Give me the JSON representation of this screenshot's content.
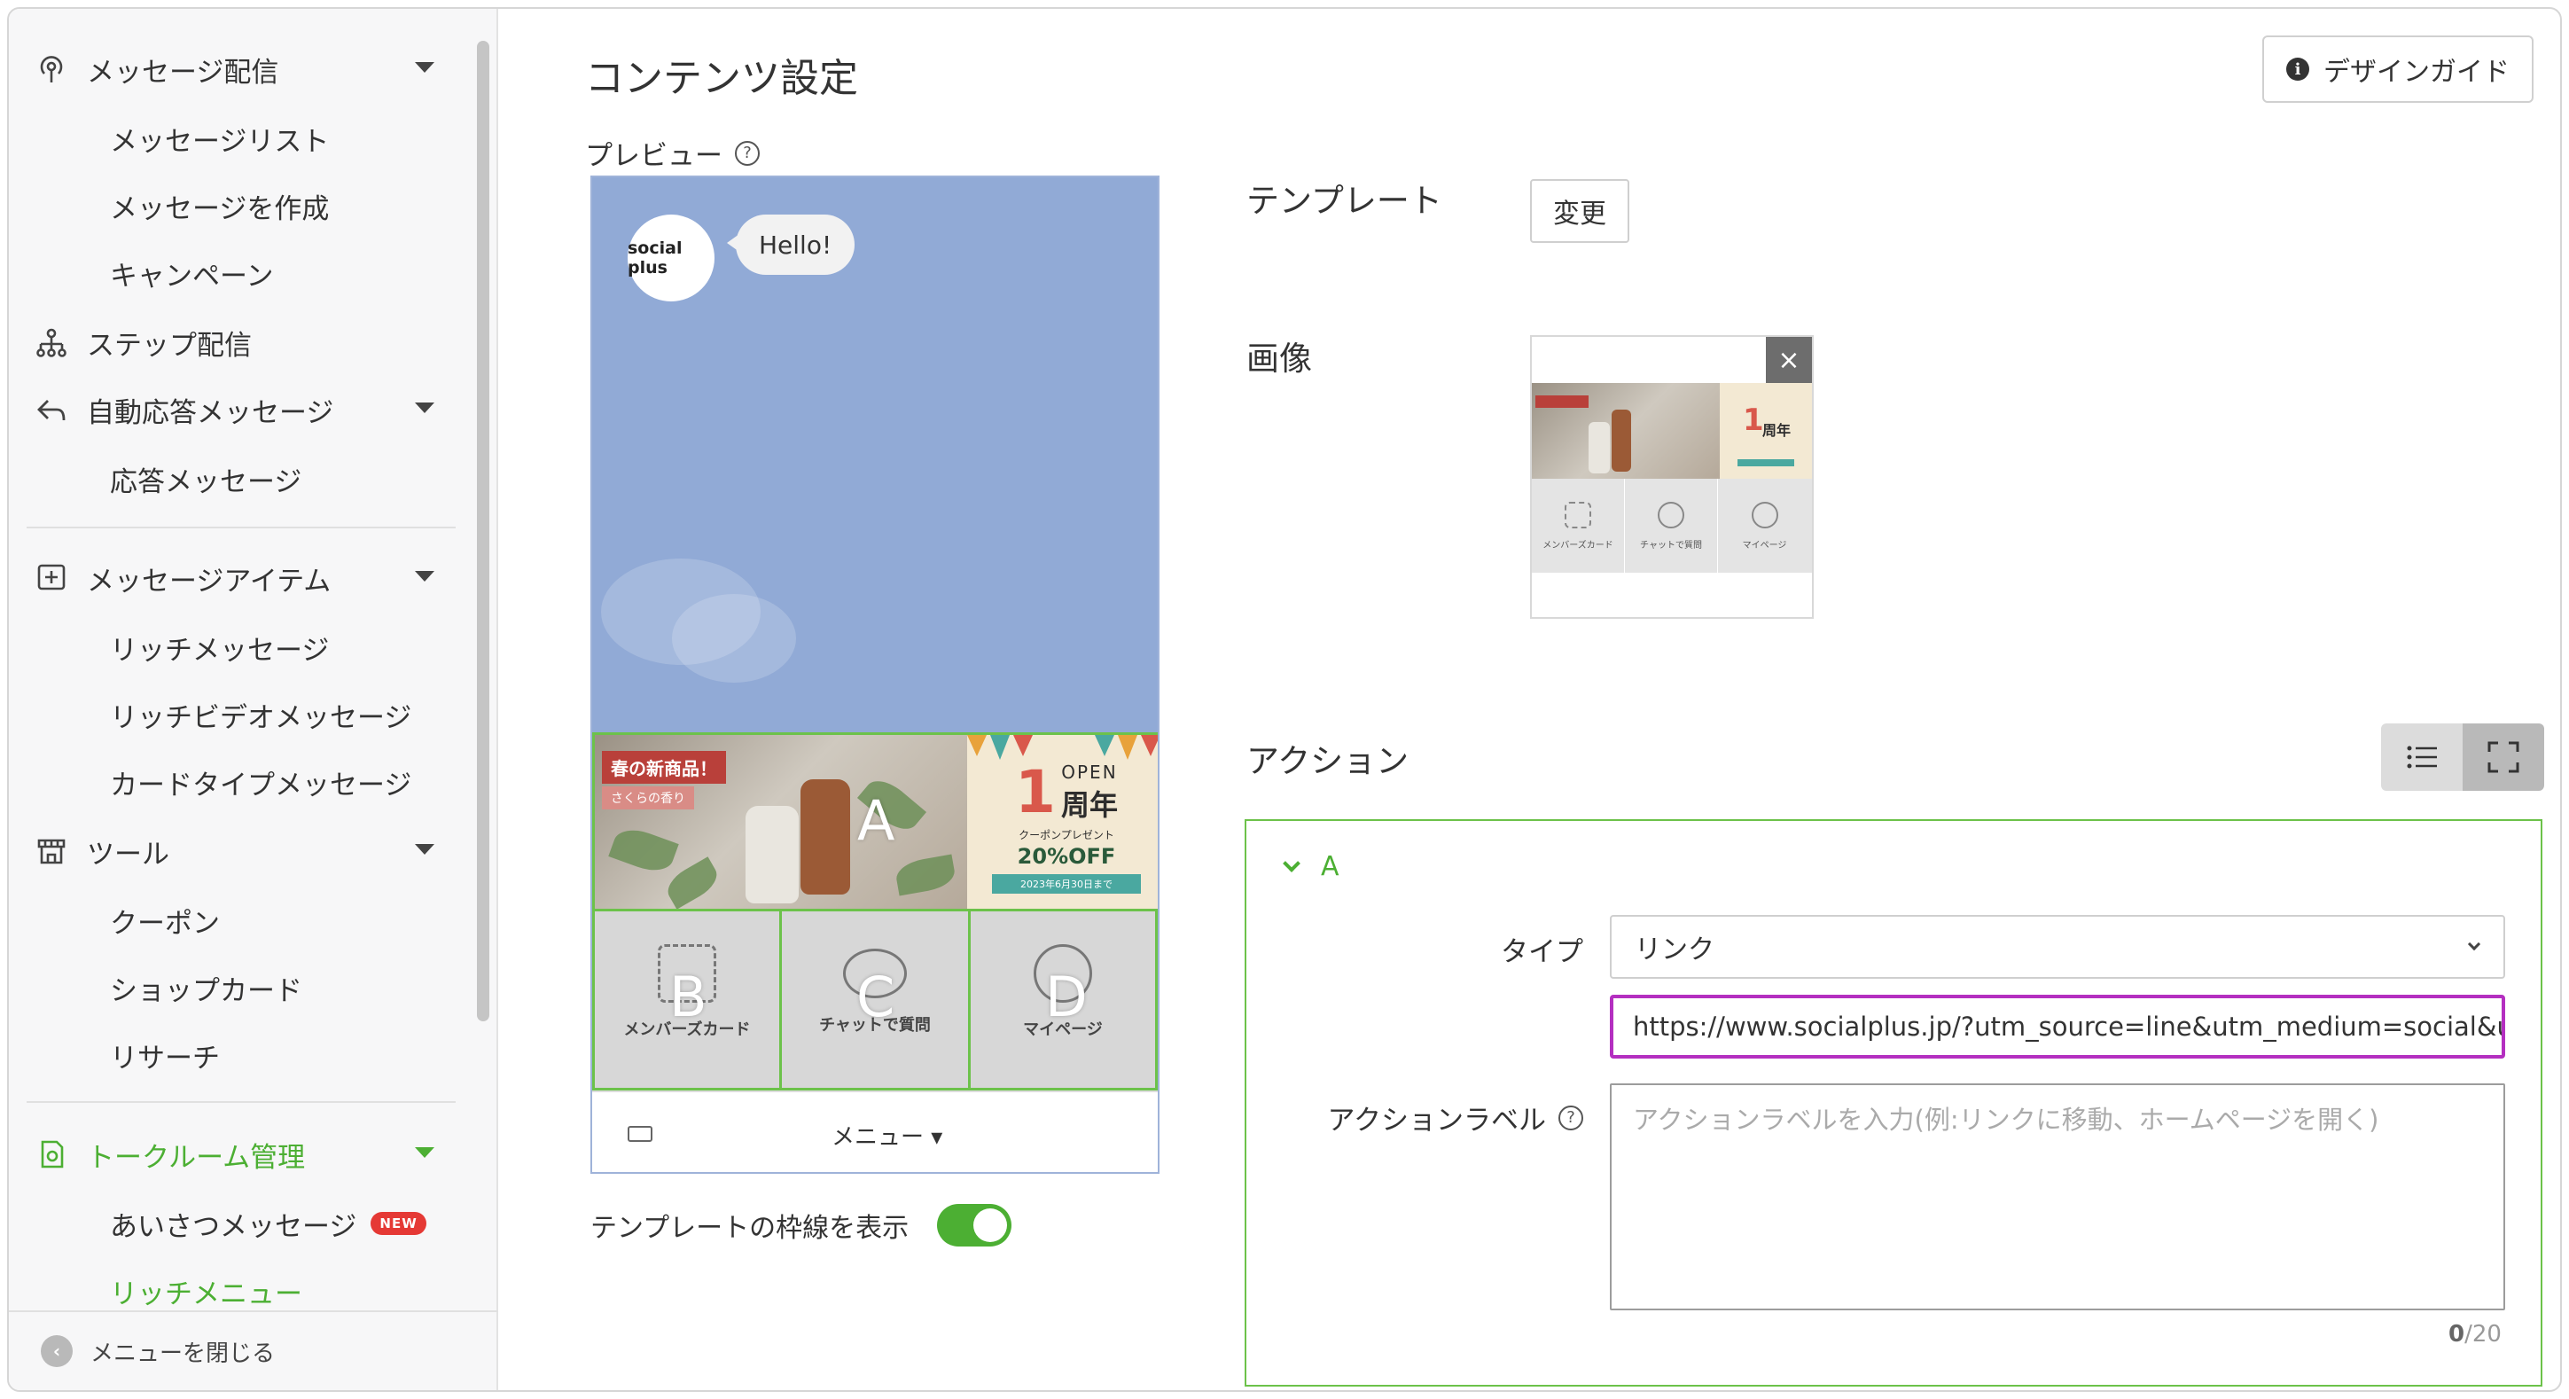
{
  "sidebar": {
    "items": [
      {
        "label": "メッセージ配信",
        "icon": "broadcast-icon"
      },
      {
        "label": "メッセージリスト"
      },
      {
        "label": "メッセージを作成"
      },
      {
        "label": "キャンペーン"
      },
      {
        "label": "ステップ配信",
        "icon": "step-tree-icon"
      },
      {
        "label": "自動応答メッセージ",
        "icon": "reply-icon"
      },
      {
        "label": "応答メッセージ"
      },
      {
        "label": "メッセージアイテム",
        "icon": "add-box-icon"
      },
      {
        "label": "リッチメッセージ"
      },
      {
        "label": "リッチビデオメッセージ"
      },
      {
        "label": "カードタイプメッセージ"
      },
      {
        "label": "ツール",
        "icon": "store-icon"
      },
      {
        "label": "クーポン"
      },
      {
        "label": "ショップカード"
      },
      {
        "label": "リサーチ"
      },
      {
        "label": "トークルーム管理",
        "icon": "talkroom-icon"
      },
      {
        "label": "あいさつメッセージ",
        "badge": "NEW"
      },
      {
        "label": "リッチメニュー"
      }
    ],
    "footer_label": "メニューを閉じる"
  },
  "main": {
    "title": "コンテンツ設定",
    "design_guide_label": "デザインガイド",
    "preview_label": "プレビュー",
    "preview": {
      "avatar_text": "social plus",
      "bubble_text": "Hello!",
      "banner_tag1": "春の新商品！",
      "banner_tag2": "さくらの香り",
      "open_line1": "OPEN",
      "open_line2": "周年",
      "open_num": "1",
      "open_sub": "クーポンプレゼント",
      "open_discount": "20%OFF",
      "open_date": "2023年6月30日まで",
      "cells": [
        {
          "letter": "A"
        },
        {
          "letter": "B",
          "label": "メンバーズカード"
        },
        {
          "letter": "C",
          "label": "チャットで質問"
        },
        {
          "letter": "D",
          "label": "マイページ"
        }
      ],
      "menu_toggle_label": "メニュー ▾"
    },
    "show_border_label": "テンプレートの枠線を表示",
    "show_border_on": true,
    "template_label": "テンプレート",
    "change_button_label": "変更",
    "image_label": "画像",
    "thumb_icons": [
      "メンバーズカード",
      "チャットで質問",
      "マイページ"
    ],
    "action_label": "アクション",
    "action": {
      "section": "A",
      "type_label": "タイプ",
      "type_value": "リンク",
      "url_value": "https://www.socialplus.jp/?utm_source=line&utm_medium=social&utm_",
      "action_label_label": "アクションラベル",
      "action_label_placeholder": "アクションラベルを入力(例:リンクに移動、ホームページを開く)",
      "counter_current": "0",
      "counter_max": "/20"
    }
  },
  "colors": {
    "accent_green": "#4caf33",
    "url_border": "#b42fc0",
    "preview_bg": "#91aad6"
  }
}
